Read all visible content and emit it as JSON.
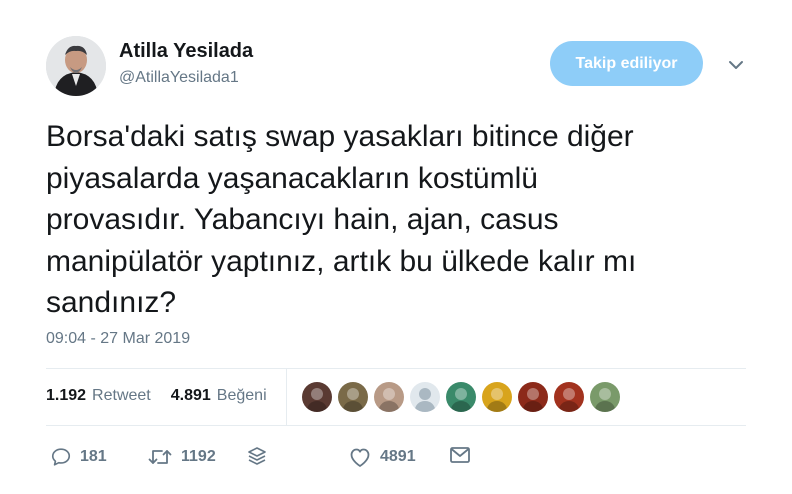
{
  "author": {
    "name": "Atilla Yesilada",
    "handle": "@AtillaYesilada1"
  },
  "follow_button": {
    "label": "Takip ediliyor"
  },
  "tweet": {
    "lines": [
      "Borsa'daki satış swap yasakları bitince diğer",
      "piyasalarda yaşanacakların kostümlü",
      "provasıdır. Yabancıyı hain, ajan, casus",
      "manipülatör yaptınız, artık bu ülkede kalır mı",
      "sandınız?"
    ],
    "timestamp": "09:04 - 27 Mar 2019"
  },
  "stats": {
    "retweet_count": "1.192",
    "retweet_label": "Retweet",
    "like_count": "4.891",
    "like_label": "Beğeni"
  },
  "likers": [
    {
      "icon": "avatar-photo",
      "color": "#5a3a32"
    },
    {
      "icon": "avatar-photo",
      "color": "#7a6a48"
    },
    {
      "icon": "avatar-photo",
      "color": "#b89a86"
    },
    {
      "icon": "avatar-default",
      "color": "#aab8c2"
    },
    {
      "icon": "avatar-photo",
      "color": "#3a8a6a"
    },
    {
      "icon": "avatar-photo",
      "color": "#d8a41c"
    },
    {
      "icon": "avatar-photo",
      "color": "#8c2a1a"
    },
    {
      "icon": "avatar-photo",
      "color": "#a2321e"
    },
    {
      "icon": "avatar-photo",
      "color": "#7a9a6a"
    }
  ],
  "actions": {
    "reply_count": "181",
    "retweet_count": "1192",
    "like_count": "4891"
  },
  "colors": {
    "accent_button": "#8ecdf8",
    "secondary_text": "#657786",
    "divider": "#e6ecf0"
  }
}
